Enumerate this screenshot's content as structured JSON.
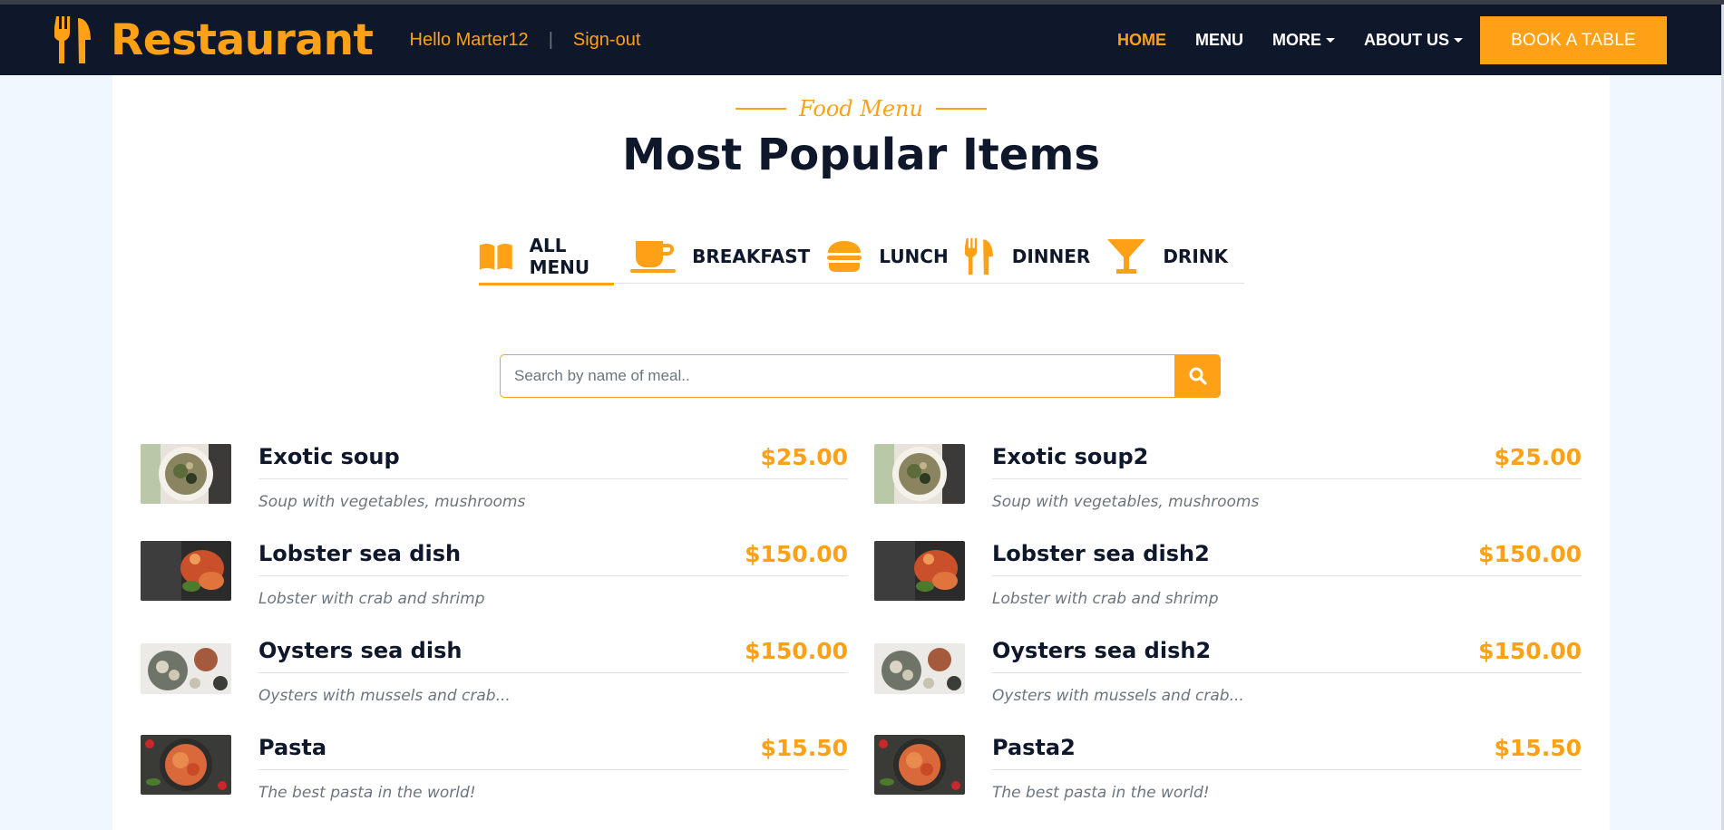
{
  "navbar": {
    "brand": "Restaurant",
    "greeting": "Hello Marter12",
    "separator": "|",
    "sign_out": "Sign-out",
    "links": [
      {
        "label": "HOME",
        "active": true,
        "dropdown": false
      },
      {
        "label": "MENU",
        "active": false,
        "dropdown": false
      },
      {
        "label": "MORE",
        "active": false,
        "dropdown": true
      },
      {
        "label": "ABOUT US",
        "active": false,
        "dropdown": true
      }
    ],
    "book_button": "BOOK A TABLE"
  },
  "section": {
    "subtitle": "Food Menu",
    "title": "Most Popular Items"
  },
  "tabs": [
    {
      "label": "ALL MENU",
      "icon": "book-icon",
      "active": true
    },
    {
      "label": "BREAKFAST",
      "icon": "coffee-icon",
      "active": false
    },
    {
      "label": "LUNCH",
      "icon": "hamburger-icon",
      "active": false
    },
    {
      "label": "DINNER",
      "icon": "utensils-icon",
      "active": false
    },
    {
      "label": "DRINK",
      "icon": "cocktail-icon",
      "active": false
    }
  ],
  "search": {
    "placeholder": "Search by name of meal..",
    "button_icon": "search-icon"
  },
  "menu_items": [
    {
      "name": "Exotic soup",
      "price": "$25.00",
      "description": "Soup with vegetables, mushrooms",
      "image": "soup"
    },
    {
      "name": "Exotic soup2",
      "price": "$25.00",
      "description": "Soup with vegetables, mushrooms",
      "image": "soup"
    },
    {
      "name": "Lobster sea dish",
      "price": "$150.00",
      "description": "Lobster with crab and shrimp",
      "image": "lobster"
    },
    {
      "name": "Lobster sea dish2",
      "price": "$150.00",
      "description": "Lobster with crab and shrimp",
      "image": "lobster"
    },
    {
      "name": "Oysters sea dish",
      "price": "$150.00",
      "description": "Oysters with mussels and crab...",
      "image": "oysters"
    },
    {
      "name": "Oysters sea dish2",
      "price": "$150.00",
      "description": "Oysters with mussels and crab...",
      "image": "oysters"
    },
    {
      "name": "Pasta",
      "price": "$15.50",
      "description": "The best pasta in the world!",
      "image": "pasta"
    },
    {
      "name": "Pasta2",
      "price": "$15.50",
      "description": "The best pasta in the world!",
      "image": "pasta"
    }
  ],
  "colors": {
    "accent": "#fea116",
    "navbar_bg": "#0f172b",
    "page_bg": "#f0f7fe",
    "panel_bg": "#ffffff",
    "heading": "#0f172b",
    "muted": "#6c757d"
  }
}
